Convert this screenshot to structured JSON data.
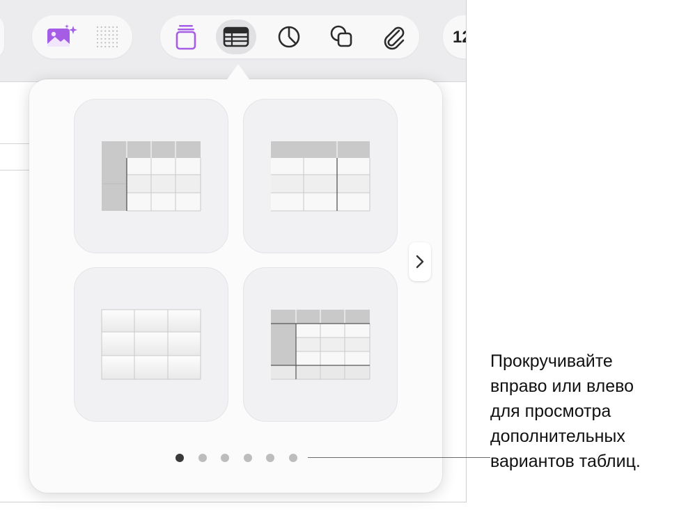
{
  "toolbar": {
    "buttons": [
      {
        "icon": "photo-sparkle-icon"
      },
      {
        "icon": "dot-grid-icon"
      },
      {
        "icon": "text-box-icon"
      },
      {
        "icon": "table-icon",
        "active": true
      },
      {
        "icon": "chart-icon"
      },
      {
        "icon": "shape-icon"
      },
      {
        "icon": "paperclip-icon"
      }
    ],
    "number_label": "12"
  },
  "popover": {
    "tiles": [
      {
        "name": "table-style-1"
      },
      {
        "name": "table-style-2"
      },
      {
        "name": "table-style-3"
      },
      {
        "name": "table-style-4"
      }
    ],
    "next_icon": "chevron-right-icon",
    "page_dots": {
      "count": 6,
      "active_index": 0
    }
  },
  "callout": {
    "lines": [
      "Прокручивайте",
      "вправо или влево",
      "для просмотра",
      "дополнительных",
      "вариантов таблиц."
    ]
  },
  "colors": {
    "accent": "#a55de6",
    "header_cell": "#c9c9c9",
    "body_cell": "#efefef"
  }
}
